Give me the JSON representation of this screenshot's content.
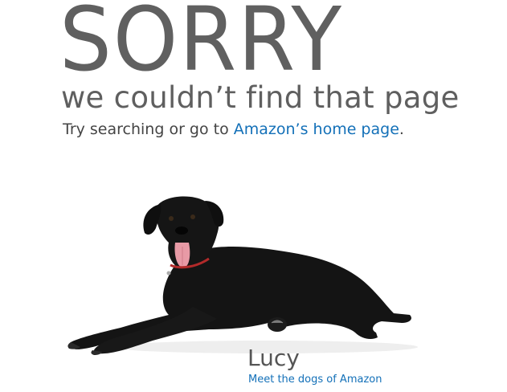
{
  "heading": "SORRY",
  "subheading": "we couldn’t find that page",
  "message": {
    "prefix": "Try searching or go to ",
    "link_text": "Amazon’s home page",
    "suffix": "."
  },
  "dog": {
    "name": "Lucy",
    "link_text": "Meet the dogs of Amazon",
    "image": "black-labrador-dog-lying-down"
  },
  "colors": {
    "link": "#1370b8",
    "heading": "#606060",
    "text": "#444444"
  }
}
